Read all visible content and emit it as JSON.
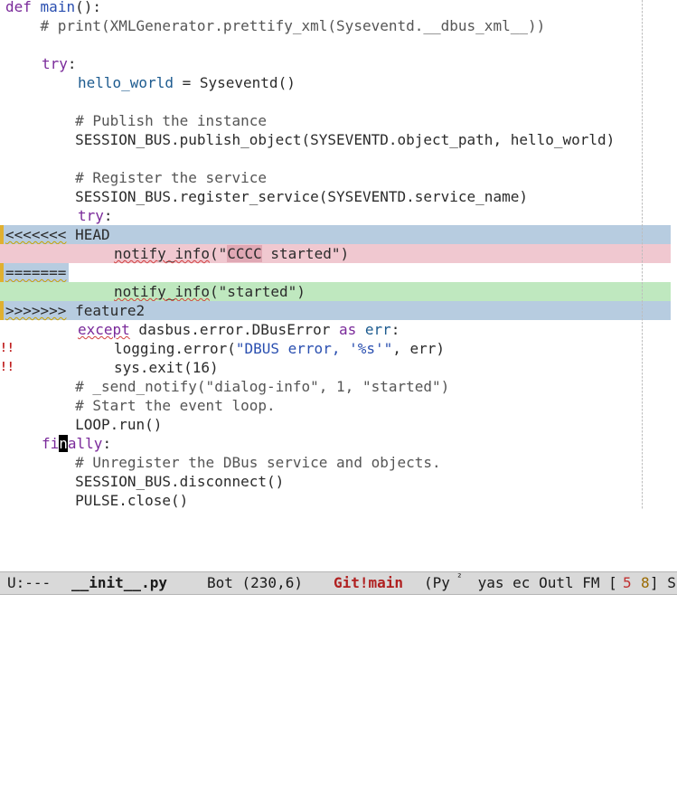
{
  "code": {
    "l1_def": "def",
    "l1_name": "main",
    "l1_rest": "():",
    "l2": "    # print(XMLGenerator.prettify_xml(Syseventd.__dbus_xml__))",
    "l4_try": "try",
    "l4_colon": ":",
    "l5_var": "hello_world",
    "l5_rest": " = Syseventd()",
    "l7": "        # Publish the instance",
    "l8": "        SESSION_BUS.publish_object(SYSEVENTD.object_path, hello_world)",
    "l10": "        # Register the service",
    "l11": "        SESSION_BUS.register_service(SYSEVENTD.service_name)",
    "l12_try": "try",
    "l12_colon": ":",
    "l13_marker": "<<<<<<<",
    "l13_label": " HEAD",
    "l14_fn": "notify_info",
    "l14_pre": "(\"",
    "l14_word": "CCCC",
    "l14_post": " started\")",
    "l15_marker": "=======",
    "l16_fn": "notify_info",
    "l16_rest": "(\"started\")",
    "l17_marker": ">>>>>>>",
    "l17_label": " feature2",
    "l18_except": "except",
    "l18_mid": " dasbus.error.DBusError ",
    "l18_as": "as",
    "l18_err": "err",
    "l18_colon": ":",
    "l19_pre": "logging.error(",
    "l19_str": "\"DBUS error, '%s'\"",
    "l19_post": ", err)",
    "l20": "sys.exit(16)",
    "l21": "        # _send_notify(\"dialog-info\", 1, \"started\")",
    "l22": "        # Start the event loop.",
    "l23": "        LOOP.run()",
    "l24_fi": "fi",
    "l24_cursor": "n",
    "l24_rest": "ally",
    "l24_colon": ":",
    "l25": "        # Unregister the DBus service and objects.",
    "l26": "        SESSION_BUS.disconnect()",
    "l27": "        PULSE.close()"
  },
  "fringe": {
    "bang": "!!"
  },
  "modeline": {
    "state": "U:---",
    "filename": "__init__.py",
    "position": "Bot (230,6)",
    "vc": "Git!main",
    "modes_pre": "(Py",
    "modes_sup": "²",
    "modes_post": " yas ec Outl FM [",
    "flycheck_err": "5",
    "flycheck_warn": "8",
    "modes_tail": "] S"
  },
  "colors": {
    "conflict_header": "#b7cce0",
    "conflict_mine": "#f0c8d0",
    "conflict_theirs": "#bfe8bf",
    "keyword": "#7a2a9a",
    "string": "#2a4fb0"
  }
}
